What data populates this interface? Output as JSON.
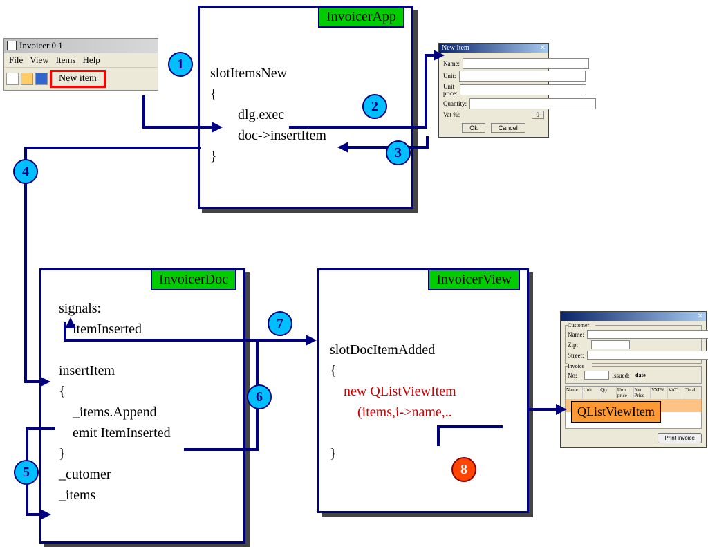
{
  "app_window": {
    "title": "Invoicer 0.1",
    "menus": [
      "File",
      "View",
      "Items",
      "Help"
    ],
    "new_item_button": "New item"
  },
  "invoicer_app": {
    "title": "InvoicerApp",
    "line1": "slotItemsNew",
    "line2": "{",
    "line3": "dlg.exec",
    "line4": "doc->insertItem",
    "line5": "}"
  },
  "new_item_dialog": {
    "title": "New Item",
    "labels": [
      "Name:",
      "Unit:",
      "Unit price:",
      "Quantity:",
      "Vat %:"
    ],
    "vat_value": "0",
    "ok": "Ok",
    "cancel": "Cancel"
  },
  "invoicer_doc": {
    "title": "InvoicerDoc",
    "signals_label": "signals:",
    "signal1": "itemInserted",
    "insert_item": "insertItem",
    "brace_open": "{",
    "line_append": "_items.Append",
    "line_emit": "emit ItemInserted",
    "brace_close": "}",
    "member1": "_cutomer",
    "member2": "_items"
  },
  "invoicer_view": {
    "title": "InvoicerView",
    "slot": "slotDocItemAdded",
    "brace_open": "{",
    "new_line1": "new QListViewItem",
    "new_line2": "(items,i->name,..",
    "brace_close": "}"
  },
  "invoicer_view_window": {
    "customer_group": "Customer",
    "name": "Name:",
    "zip": "Zip:",
    "street": "Street:",
    "invoice_group": "Invoice",
    "no": "No:",
    "issued": "Issued:",
    "date": "date",
    "columns": [
      "Name",
      "Unit",
      "Qty",
      "Unit price",
      "Net Price",
      "VAT%",
      "VAT",
      "Total"
    ],
    "print_btn": "Print invoice"
  },
  "qlist_item_label": "QListViewItem",
  "badges": {
    "1": "1",
    "2": "2",
    "3": "3",
    "4": "4",
    "5": "5",
    "6": "6",
    "7": "7",
    "8": "8"
  }
}
